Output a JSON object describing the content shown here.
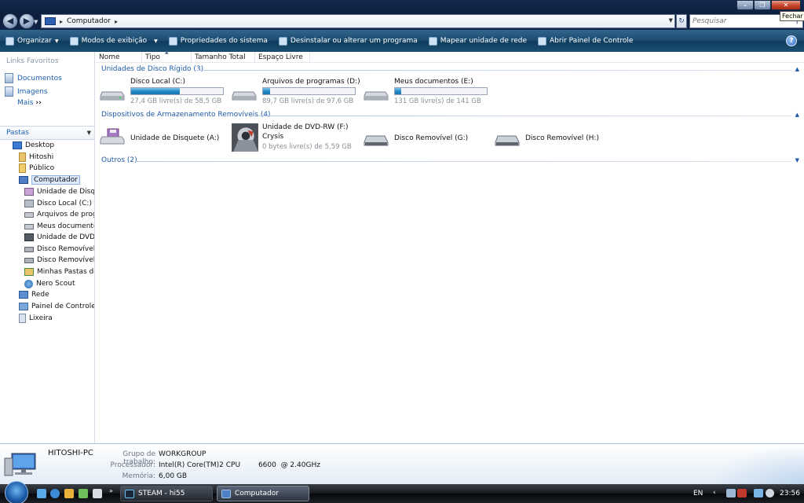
{
  "window": {
    "address_path": "Computador",
    "search_placeholder": "Pesquisar",
    "tooltip": "Fechar"
  },
  "toolbar": {
    "organize": "Organizar",
    "views": "Modos de exibição",
    "system_properties": "Propriedades do sistema",
    "uninstall": "Desinstalar ou alterar um programa",
    "map_drive": "Mapear unidade de rede",
    "control_panel": "Abrir Painel de Controle"
  },
  "left": {
    "favorites_title": "Links Favoritos",
    "favorites": [
      "Documentos",
      "Imagens"
    ],
    "more": "Mais",
    "folders_title": "Pastas",
    "tree": [
      "Desktop",
      "Hitoshi",
      "Público",
      "Computador",
      "Unidade de Disque",
      "Disco Local (C:)",
      "Arquivos de progr",
      "Meus documentos",
      "Unidade de DVD-I",
      "Disco Removível (",
      "Disco Removível (",
      "Minhas Pastas de C",
      "Nero Scout",
      "Rede",
      "Painel de Controle",
      "Lixeira"
    ]
  },
  "columns": [
    "Nome",
    "Tipo",
    "Tamanho Total",
    "Espaço Livre"
  ],
  "groups": {
    "hard_disks": "Unidades de Disco Rígido (3)",
    "removable": "Dispositivos de Armazenamento Removíveis (4)",
    "others": "Outros (2)"
  },
  "drives": [
    {
      "name": "Disco Local (C:)",
      "info": "27,4 GB livre(s) de 58,5 GB",
      "used_fraction": 0.53
    },
    {
      "name": "Arquivos de programas (D:)",
      "info": "89,7 GB livre(s) de 97,6 GB",
      "used_fraction": 0.08
    },
    {
      "name": "Meus documentos (E:)",
      "info": "131 GB livre(s) de 141 GB",
      "used_fraction": 0.07
    }
  ],
  "removables": [
    {
      "name": "Unidade de Disquete (A:)"
    },
    {
      "name": "Unidade de DVD-RW (F:)",
      "sub": "Crysis",
      "info": "0 bytes livre(s) de 5,59 GB"
    },
    {
      "name": "Disco Removível (G:)"
    },
    {
      "name": "Disco Removível (H:)"
    }
  ],
  "details": {
    "pc_name": "HITOSHI-PC",
    "workgroup_label": "Grupo de trabalho:",
    "workgroup": "WORKGROUP",
    "processor_label": "Processador:",
    "processor": "Intel(R) Core(TM)2 CPU        6600  @ 2.40GHz",
    "memory_label": "Memória:",
    "memory": "6,00 GB"
  },
  "taskbar": {
    "tasks": [
      "STEAM - hi55",
      "Computador"
    ],
    "language": "EN",
    "clock": "23:56"
  }
}
